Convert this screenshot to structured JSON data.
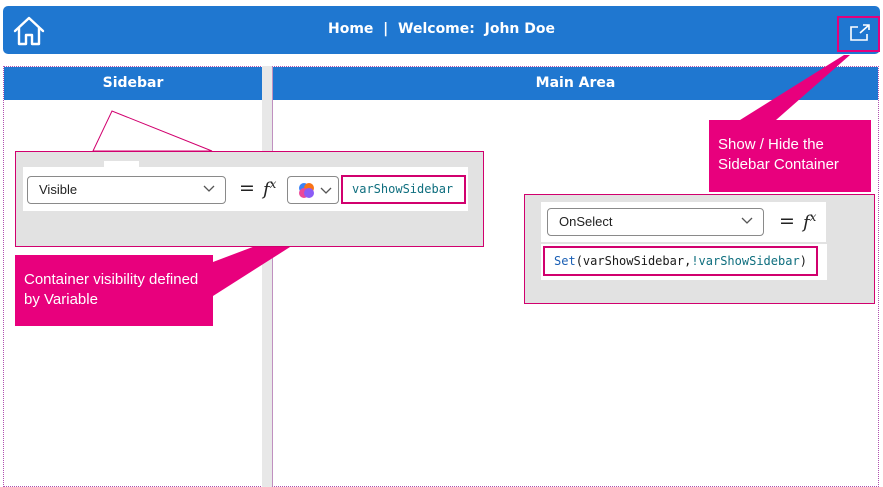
{
  "header": {
    "title": "Home  |  Welcome:  John Doe",
    "home_icon": "home-icon",
    "toggle_icon": "open-external-icon"
  },
  "sidebar": {
    "title": "Sidebar"
  },
  "main": {
    "title": "Main Area"
  },
  "sidebar_property": {
    "property": "Visible",
    "equals": "=",
    "fx": "fx",
    "formula": "varShowSidebar"
  },
  "button_property": {
    "property": "OnSelect",
    "equals": "=",
    "fx": "fx",
    "formula_fn": "Set",
    "formula_open": "(",
    "formula_arg1": "varShowSidebar",
    "formula_comma": ",",
    "formula_arg2": "!varShowSidebar",
    "formula_close": ")"
  },
  "callouts": {
    "toggle": "Show / Hide the Sidebar Container",
    "visibility": "Container visibility defined by Variable"
  },
  "colors": {
    "header_blue": "#1f77d0",
    "accent_pink": "#e8007d",
    "panel_grey": "#e2e2e2"
  }
}
